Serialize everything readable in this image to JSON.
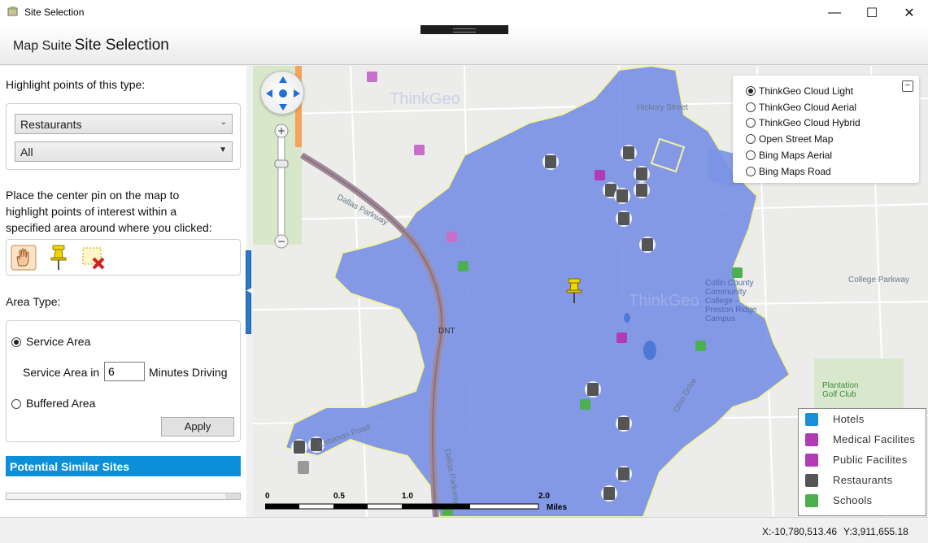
{
  "window": {
    "title": "Site Selection",
    "minimize_glyph": "—",
    "maximize_glyph": "☐",
    "close_glyph": "✕"
  },
  "header": {
    "brand_prefix": "Map Suite",
    "brand_title": "Site Selection"
  },
  "left_panel": {
    "highlight_label": "Highlight points of this type:",
    "type_select": {
      "value": "Restaurants",
      "caret": "⌄"
    },
    "subtype_select": {
      "value": "All",
      "caret": "▼"
    },
    "instructions": [
      "Place the center pin on the map to",
      "highlight points of interest within a",
      "specified area around where you clicked:"
    ],
    "tools": [
      {
        "name": "pan-hand-icon"
      },
      {
        "name": "pushpin-icon"
      },
      {
        "name": "clear-selection-icon"
      }
    ],
    "area_type_label": "Area Type:",
    "service_area_radio": "Service Area",
    "service_area_in": "Service Area in",
    "minutes_value": "6",
    "minutes_suffix": "Minutes Driving",
    "buffered_area_radio": "Buffered Area",
    "apply_label": "Apply",
    "potential_sites_header": "Potential Similar Sites"
  },
  "map": {
    "layers": [
      {
        "label": "ThinkGeo Cloud Light",
        "selected": true
      },
      {
        "label": "ThinkGeo Cloud Aerial",
        "selected": false
      },
      {
        "label": "ThinkGeo Cloud Hybrid",
        "selected": false
      },
      {
        "label": "Open Street Map",
        "selected": false
      },
      {
        "label": "Bing Maps Aerial",
        "selected": false
      },
      {
        "label": "Bing Maps Road",
        "selected": false
      }
    ],
    "collapse_glyph": "−",
    "legend": [
      {
        "label": "Hotels",
        "color": "#1a8fd8",
        "icon": "hotel-icon"
      },
      {
        "label": "Medical Facilites",
        "color": "#b13bb5",
        "icon": "medical-icon"
      },
      {
        "label": "Public Facilites",
        "color": "#b13bb5",
        "icon": "public-facility-icon"
      },
      {
        "label": "Restaurants",
        "color": "#555555",
        "icon": "restaurant-icon"
      },
      {
        "label": "Schools",
        "color": "#4caf50",
        "icon": "school-icon"
      }
    ],
    "scale_ticks": [
      "0",
      "0.5",
      "1.0",
      "2.0"
    ],
    "scale_unit": "Miles",
    "labels": {
      "hickory": "Hickory Street",
      "dallas_pkwy": "Dallas Parkway",
      "college_pkwy": "College Parkway",
      "collin": "Collin County Community College - Preston Ridge Campus",
      "plantation": "Plantation Golf Club",
      "dnt": "DNT",
      "ohio": "Ohio Drive",
      "lebanon": "Lebanon Road",
      "dallas_pkwy2": "Dallas Parkway",
      "watermark": "ThinkGeo"
    },
    "service_area_color": "#7b93e6"
  },
  "status": {
    "x": "X:-10,780,513.46",
    "y": "Y:3,911,655.18"
  }
}
